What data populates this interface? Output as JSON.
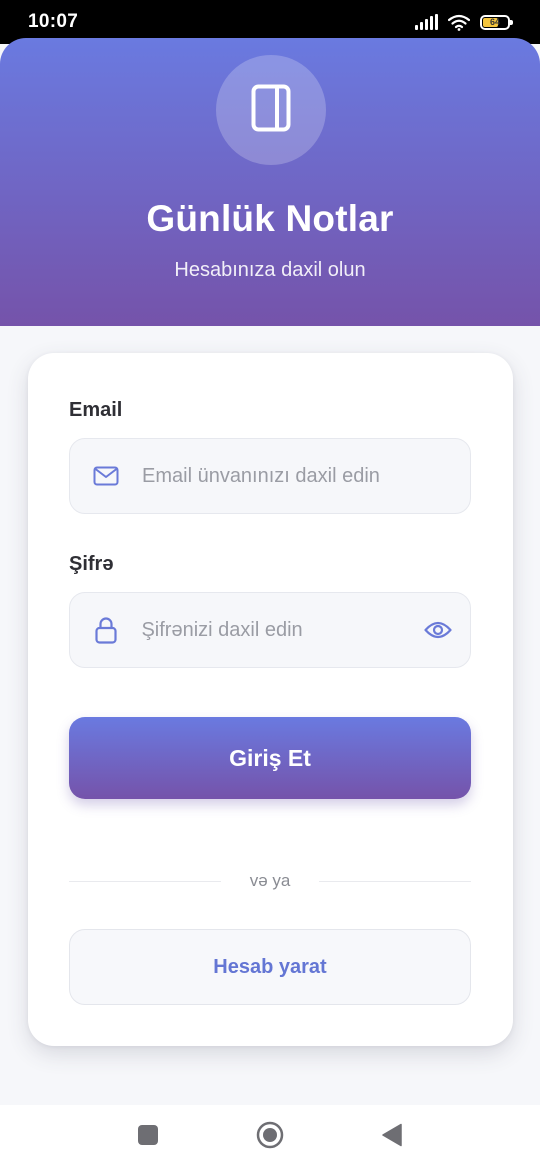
{
  "status_bar": {
    "time": "10:07",
    "battery": "64",
    "battery_level": 0.64
  },
  "header": {
    "icon": "notebook-icon",
    "title": "Günlük Notlar",
    "subtitle": "Hesabınıza daxil olun"
  },
  "form": {
    "email": {
      "label": "Email",
      "value": "",
      "placeholder": "Email ünvanınızı daxil edin",
      "icon": "mail-icon"
    },
    "password": {
      "label": "Şifrə",
      "value": "",
      "placeholder": "Şifrənizi daxil edin",
      "icon": "lock-icon",
      "toggle_icon": "eye-icon"
    },
    "login_button": "Giriş Et",
    "divider": "və ya",
    "register_button": "Hesab yarat"
  },
  "nav": {
    "recents_icon": "square-icon",
    "home_icon": "circle-icon",
    "back_icon": "back-triangle-icon"
  },
  "colors": {
    "gradient_top": "#6a7ae0",
    "gradient_bottom": "#7553aa",
    "accent_text": "#6476d4"
  }
}
